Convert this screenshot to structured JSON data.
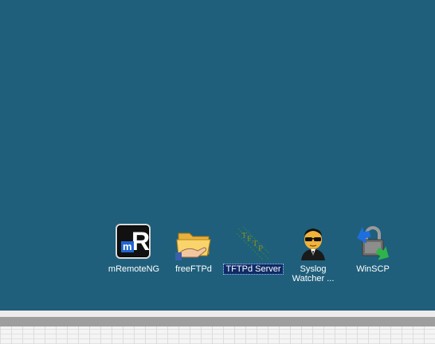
{
  "desktop": {
    "background_color": "#1f5f7b",
    "icons": [
      {
        "label": "mRemoteNG",
        "icon": "mremoteng-icon",
        "selected": false
      },
      {
        "label": "freeFTPd",
        "icon": "folder-hand-icon",
        "selected": false
      },
      {
        "label": "TFTPd Server",
        "icon": "tftpd-icon",
        "selected": true
      },
      {
        "label": "Syslog Watcher ...",
        "icon": "agent-sunglasses-icon",
        "selected": false
      },
      {
        "label": "WinSCP",
        "icon": "winscp-lock-icon",
        "selected": false
      }
    ]
  }
}
